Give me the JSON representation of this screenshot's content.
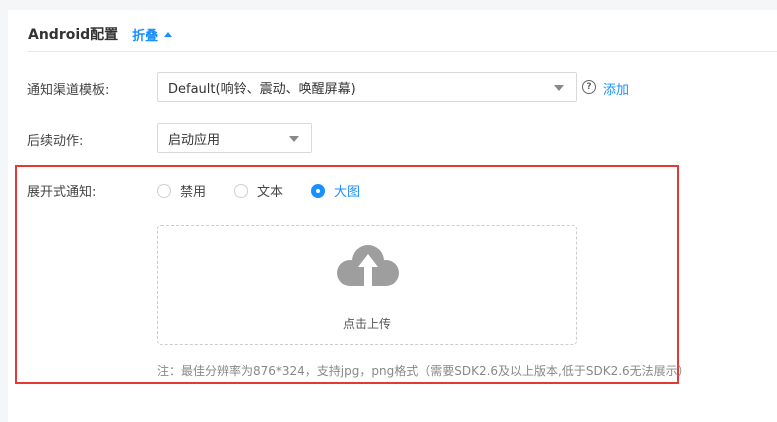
{
  "header": {
    "title": "Android配置",
    "collapse_label": "折叠"
  },
  "form": {
    "channel_template": {
      "label": "通知渠道模板:",
      "value": "Default(响铃、震动、唤醒屏幕)",
      "help_icon_text": "?",
      "add_label": "添加"
    },
    "followup_action": {
      "label": "后续动作:",
      "value": "启动应用"
    },
    "expanded_notification": {
      "label": "展开式通知:",
      "options": [
        {
          "label": "禁用",
          "checked": false
        },
        {
          "label": "文本",
          "checked": false
        },
        {
          "label": "大图",
          "checked": true
        }
      ],
      "upload_label": "点击上传",
      "note": "注：最佳分辨率为876*324，支持jpg，png格式（需要SDK2.6及以上版本,低于SDK2.6无法展示）"
    }
  },
  "colors": {
    "accent": "#1890ff",
    "highlight": "#e53935",
    "upload_icon": "#9e9e9e"
  },
  "icons": {
    "caret": "caret-up-icon",
    "help": "question-circle-icon",
    "upload": "cloud-upload-icon",
    "dropdown": "chevron-down-icon"
  }
}
